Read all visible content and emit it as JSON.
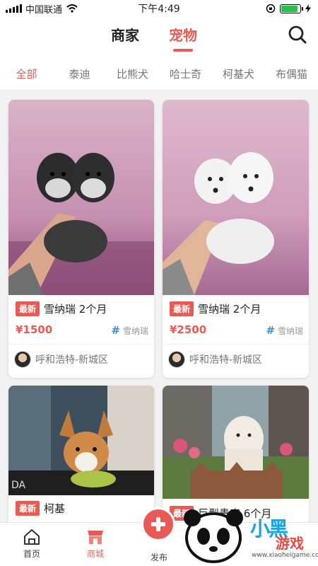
{
  "status_bar": {
    "carrier": "中国联通",
    "time": "下午4:49",
    "battery_level": 0.9
  },
  "header": {
    "tab_merchant": "商家",
    "tab_pets": "宠物",
    "active_tab": "宠物"
  },
  "categories": [
    "全部",
    "泰迪",
    "比熊犬",
    "哈士奇",
    "柯基犬",
    "布偶猫"
  ],
  "active_category": "全部",
  "listings": [
    {
      "badge": "最新",
      "title": "雪纳瑞 2个月",
      "price": "¥1500",
      "tag": "雪纳瑞",
      "seller": "呼和浩特-新城区",
      "photo_icon": "schnauzer-puppies-photo"
    },
    {
      "badge": "最新",
      "title": "雪纳瑞 2个月",
      "price": "¥2500",
      "tag": "雪纳瑞",
      "seller": "呼和浩特-新城区",
      "photo_icon": "white-schnauzer-puppies-photo"
    },
    {
      "badge": "最新",
      "title": "柯基",
      "photo_icon": "corgi-photo"
    },
    {
      "badge": "最新",
      "title": "巨型贵宾 6个月",
      "photo_icon": "poodle-photo"
    }
  ],
  "bottom_nav": {
    "home": "首页",
    "shop": "商城",
    "publish": "发布",
    "active": "商城"
  },
  "watermark": {
    "text": "小黑游戏",
    "text_part1": "小黑",
    "text_part2": "游戏",
    "url": "www.xiaoheigame.com"
  },
  "colors": {
    "accent": "#e85b55",
    "tag_hash": "#3b8fd6",
    "muted": "#999999"
  }
}
